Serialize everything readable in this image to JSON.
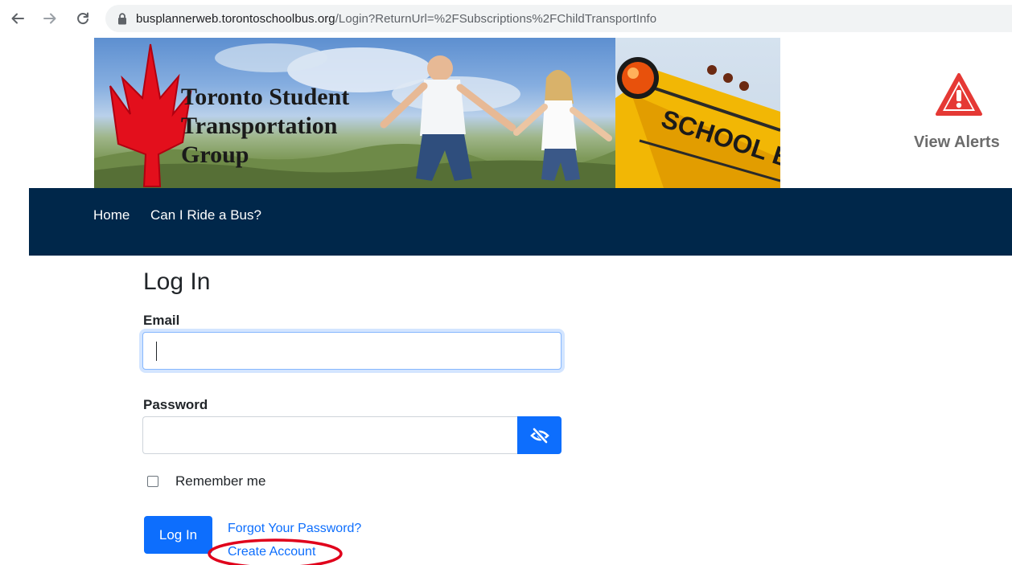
{
  "browser": {
    "url_host": "busplannerweb.torontoschoolbus.org",
    "url_path": "/Login?ReturnUrl=%2FSubscriptions%2FChildTransportInfo"
  },
  "banner": {
    "title_line1": "Toronto Student",
    "title_line2": "Transportation",
    "title_line3": "Group",
    "bus_sign": "SCHOOL BUS"
  },
  "alerts": {
    "label": "View Alerts",
    "icon": "warning-triangle-icon"
  },
  "nav": {
    "items": [
      {
        "label": "Home"
      },
      {
        "label": "Can I Ride a Bus?"
      }
    ]
  },
  "login": {
    "title": "Log In",
    "email_label": "Email",
    "email_value": "",
    "password_label": "Password",
    "password_value": "",
    "password_toggle_icon": "eye-slash-icon",
    "remember_label": "Remember me",
    "remember_checked": false,
    "submit_label": "Log In",
    "forgot_link": "Forgot Your Password?",
    "create_link": "Create Account"
  },
  "colors": {
    "navbar": "#00274a",
    "primary": "#0d6efd",
    "annotation": "#e0001b",
    "alert": "#e53935"
  }
}
